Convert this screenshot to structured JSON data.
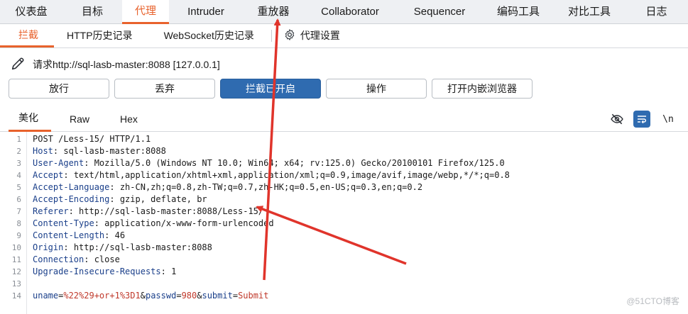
{
  "top_tabs": [
    "仪表盘",
    "目标",
    "代理",
    "Intruder",
    "重放器",
    "Collaborator",
    "Sequencer",
    "编码工具",
    "对比工具",
    "日志"
  ],
  "active_top_tab": "代理",
  "sub_tabs": {
    "intercept": "拦截",
    "http_history": "HTTP历史记录",
    "ws_history": "WebSocket历史记录",
    "proxy_settings": "代理设置"
  },
  "request_line": "请求http://sql-lasb-master:8088  [127.0.0.1]",
  "buttons": {
    "forward": "放行",
    "drop": "丢弃",
    "intercept_on": "拦截已开启",
    "action": "操作",
    "open_browser": "打开内嵌浏览器"
  },
  "editor_tabs": {
    "pretty": "美化",
    "raw": "Raw",
    "hex": "Hex"
  },
  "newline_toggle": "\\n",
  "line_numbers": [
    "1",
    "2",
    "3",
    "4",
    "5",
    "6",
    "7",
    "8",
    "9",
    "10",
    "11",
    "12",
    "13",
    "14"
  ],
  "request_start": "POST /Less-15/ HTTP/1.1",
  "headers": [
    {
      "line": 2,
      "name": "Host",
      "value": "sql-lasb-master:8088"
    },
    {
      "line": 3,
      "name": "User-Agent",
      "value": "Mozilla/5.0 (Windows NT 10.0; Win64; x64; rv:125.0) Gecko/20100101 Firefox/125.0"
    },
    {
      "line": 4,
      "name": "Accept",
      "value": "text/html,application/xhtml+xml,application/xml;q=0.9,image/avif,image/webp,*/*;q=0.8"
    },
    {
      "line": 5,
      "name": "Accept-Language",
      "value": "zh-CN,zh;q=0.8,zh-TW;q=0.7,zh-HK;q=0.5,en-US;q=0.3,en;q=0.2"
    },
    {
      "line": 6,
      "name": "Accept-Encoding",
      "value": "gzip, deflate, br"
    },
    {
      "line": 7,
      "name": "Referer",
      "value": "http://sql-lasb-master:8088/Less-15/"
    },
    {
      "line": 8,
      "name": "Content-Type",
      "value": "application/x-www-form-urlencoded"
    },
    {
      "line": 9,
      "name": "Content-Length",
      "value": "46"
    },
    {
      "line": 10,
      "name": "Origin",
      "value": "http://sql-lasb-master:8088"
    },
    {
      "line": 11,
      "name": "Connection",
      "value": "close"
    },
    {
      "line": 12,
      "name": "Upgrade-Insecure-Requests",
      "value": "1"
    }
  ],
  "body_params": [
    {
      "name": "uname",
      "value": "%22%29+or+1%3D1"
    },
    {
      "name": "passwd",
      "value": "980"
    },
    {
      "name": "submit",
      "value": "Submit"
    }
  ],
  "watermark": "@51CTO博客",
  "colors": {
    "accent": "#e8622c",
    "primary_button": "#2f6bb0",
    "annotation_arrow": "#e0342b"
  }
}
